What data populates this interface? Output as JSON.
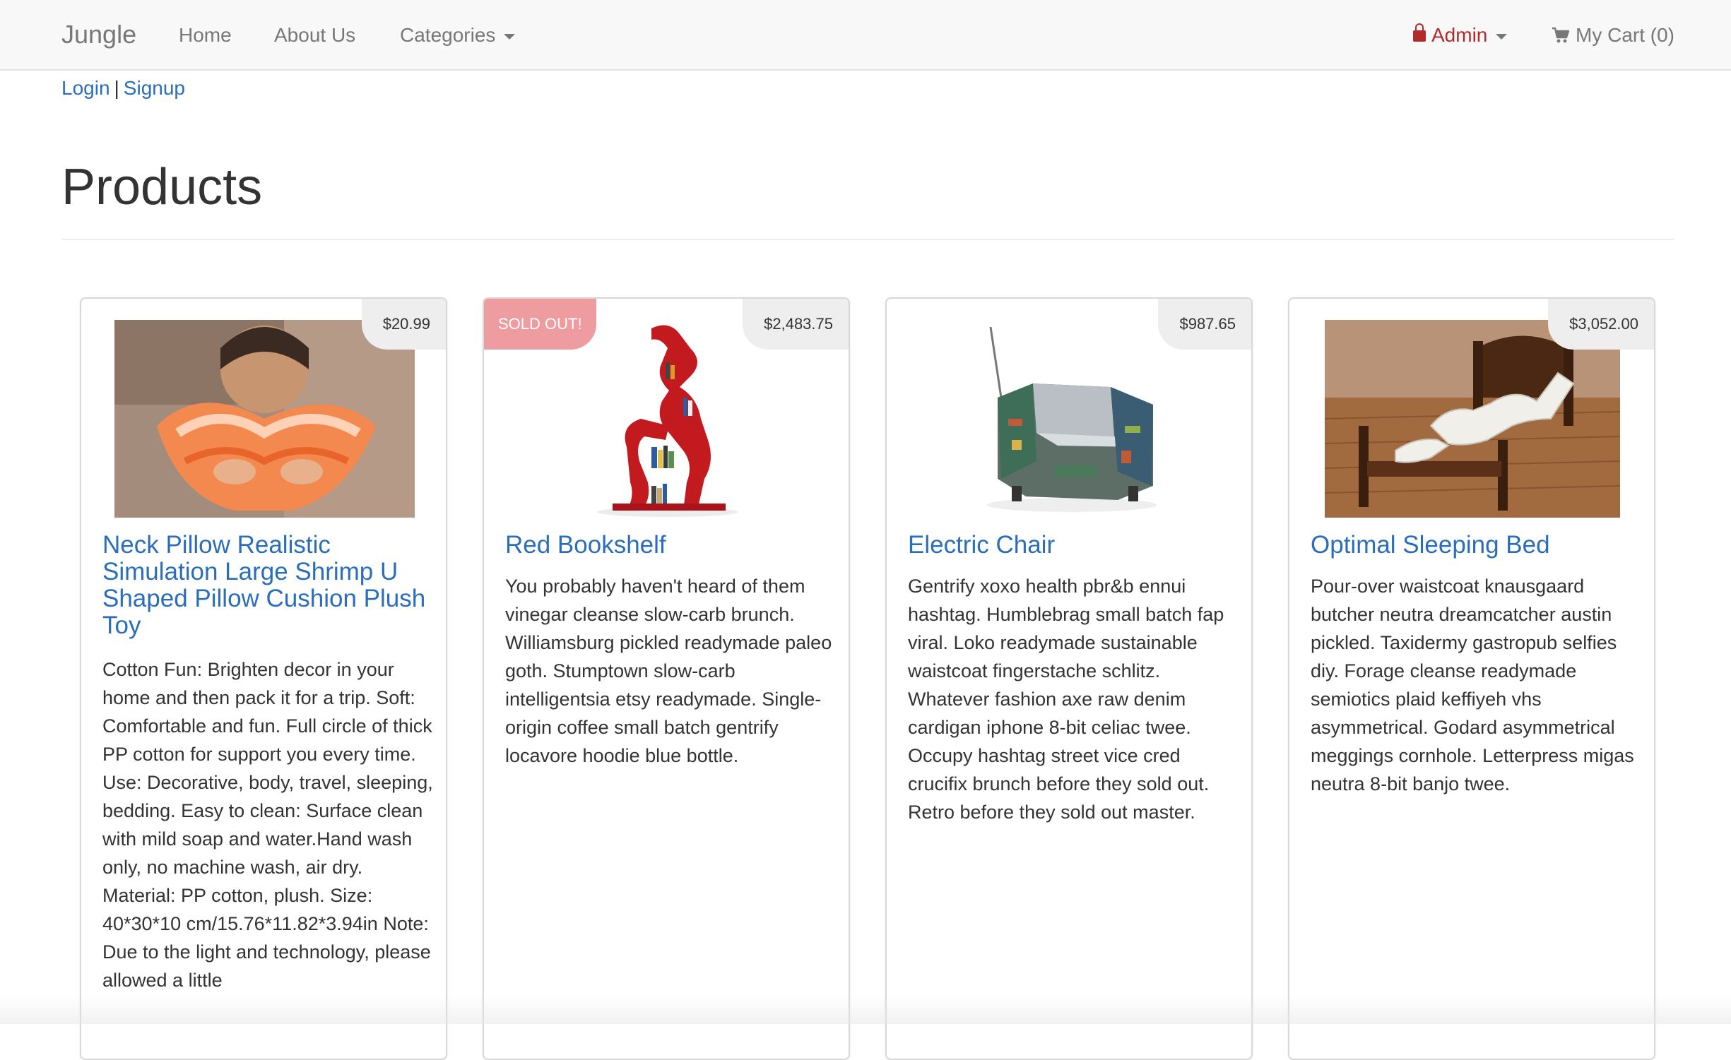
{
  "nav": {
    "brand": "Jungle",
    "home": "Home",
    "about": "About Us",
    "categories": "Categories",
    "admin": "Admin",
    "cart": "My Cart (0)"
  },
  "auth": {
    "login": "Login",
    "separator": "|",
    "signup": "Signup"
  },
  "page": {
    "title": "Products"
  },
  "products": [
    {
      "name": "Neck Pillow Realistic Simulation Large Shrimp U Shaped Pillow Cushion Plush Toy",
      "price": "$20.99",
      "sold_out": "",
      "image": "shrimp-neck-pillow-photo",
      "description": "Cotton Fun: Brighten decor in your home and then pack it for a trip. Soft: Comfortable and fun. Full circle of thick PP cotton for support you every time. Use: Decorative, body, travel, sleeping, bedding. Easy to clean: Surface clean with mild soap and water.Hand wash only, no machine wash, air dry. Material: PP cotton, plush. Size: 40*30*10 cm/15.76*11.82*3.94in Note: Due to the light and technology, please allowed a little"
    },
    {
      "name": "Red Bookshelf",
      "price": "$2,483.75",
      "sold_out": "SOLD OUT!",
      "image": "red-bookshelf-photo",
      "description": "You probably haven't heard of them vinegar cleanse slow-carb brunch. Williamsburg pickled readymade paleo goth. Stumptown slow-carb intelligentsia etsy readymade. Single-origin coffee small batch gentrify locavore hoodie blue bottle."
    },
    {
      "name": "Electric Chair",
      "price": "$987.65",
      "sold_out": "",
      "image": "circuit-board-chair-photo",
      "description": "Gentrify xoxo health pbr&b ennui hashtag. Humblebrag small batch fap viral. Loko readymade sustainable waistcoat fingerstache schlitz. Whatever fashion axe raw denim cardigan iphone 8-bit celiac twee. Occupy hashtag street vice cred crucifix brunch before they sold out. Retro before they sold out master."
    },
    {
      "name": "Optimal Sleeping Bed",
      "price": "$3,052.00",
      "sold_out": "",
      "image": "zigzag-mattress-bed-photo",
      "description": "Pour-over waistcoat knausgaard butcher neutra dreamcatcher austin pickled. Taxidermy gastropub selfies diy. Forage cleanse readymade semiotics plaid keffiyeh vhs asymmetrical. Godard asymmetrical meggings cornhole. Letterpress migas neutra 8-bit banjo twee."
    }
  ],
  "colors": {
    "link": "#2a6ebb",
    "admin": "#b22a2a",
    "sold_out_badge": "#ee9ca0",
    "navbar_bg": "#f8f8f8",
    "price_badge": "#eeeeee"
  }
}
